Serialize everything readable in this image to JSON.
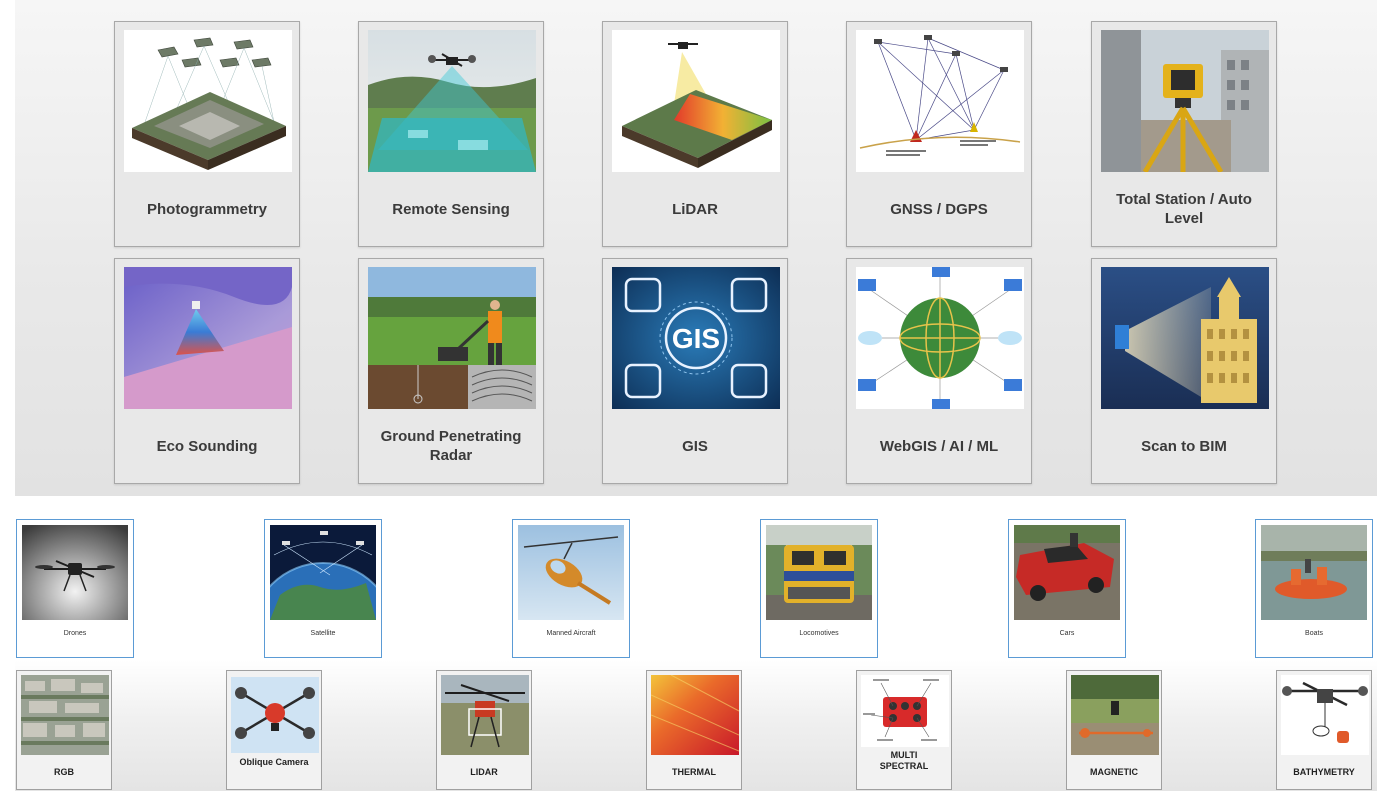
{
  "techniques": [
    {
      "label": "Photogrammetry",
      "icon": "photogrammetry-image"
    },
    {
      "label": "Remote Sensing",
      "icon": "remote-sensing-image"
    },
    {
      "label": "LiDAR",
      "icon": "lidar-image"
    },
    {
      "label": "GNSS / DGPS",
      "icon": "gnss-diagram-image"
    },
    {
      "label": "Total Station / Auto Level",
      "icon": "total-station-image"
    },
    {
      "label": "Eco Sounding",
      "icon": "eco-sounding-image"
    },
    {
      "label": "Ground Penetrating Radar",
      "icon": "gpr-image"
    },
    {
      "label": "GIS",
      "icon": "gis-image"
    },
    {
      "label": "WebGIS / AI / ML",
      "icon": "webgis-image"
    },
    {
      "label": "Scan to BIM",
      "icon": "scan-to-bim-image"
    }
  ],
  "platforms": [
    {
      "label": "Drones"
    },
    {
      "label": "Satellite"
    },
    {
      "label": "Manned Aircraft"
    },
    {
      "label": "Locomotives"
    },
    {
      "label": "Cars"
    },
    {
      "label": "Boats"
    }
  ],
  "sensors": [
    {
      "label": "RGB"
    },
    {
      "label": "Oblique Camera"
    },
    {
      "label": "LIDAR"
    },
    {
      "label": "THERMAL"
    },
    {
      "label": "MULTI SPECTRAL"
    },
    {
      "label": "MAGNETIC"
    },
    {
      "label": "BATHYMETRY"
    }
  ],
  "gis_text": "GIS",
  "colors": {
    "tile_border": "#a8a8a8",
    "platform_border": "#5b9bd5",
    "label_text": "#3b3b3b"
  }
}
